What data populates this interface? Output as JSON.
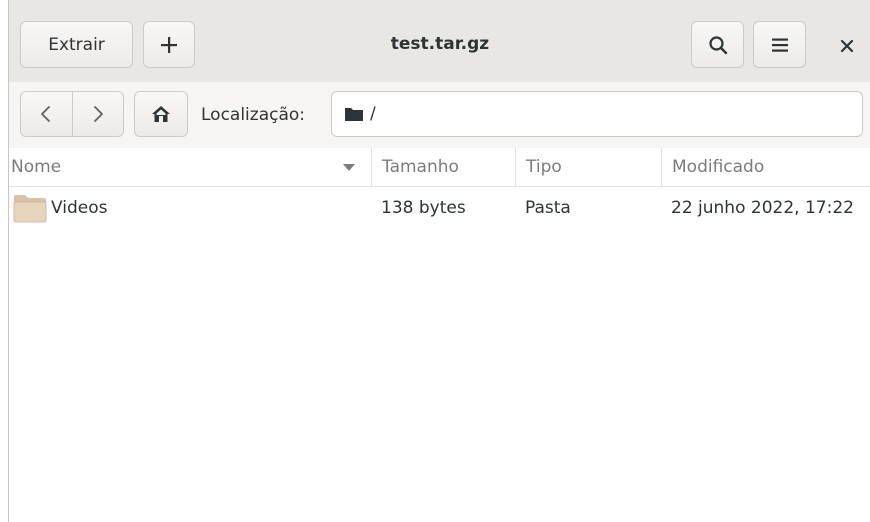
{
  "window": {
    "title": "test.tar.gz"
  },
  "headerbar": {
    "extract_label": "Extrair",
    "add_icon": "plus-icon",
    "search_icon": "search-icon",
    "menu_icon": "hamburger-menu-icon",
    "close_icon": "close-icon"
  },
  "location": {
    "back_icon": "chevron-left-icon",
    "forward_icon": "chevron-right-icon",
    "home_icon": "home-icon",
    "label": "Localização:",
    "path": "/"
  },
  "columns": {
    "name": "Nome",
    "size": "Tamanho",
    "type": "Tipo",
    "modified": "Modificado",
    "sort": "descending"
  },
  "files": [
    {
      "name": "Videos",
      "size": "138 bytes",
      "type": "Pasta",
      "modified": "22 junho 2022, 17:22",
      "icon": "folder-icon"
    }
  ],
  "colors": {
    "headerbar_bg": "#e9e7e4",
    "folder_fill": "#e7d4bd",
    "text": "#2e3436"
  }
}
